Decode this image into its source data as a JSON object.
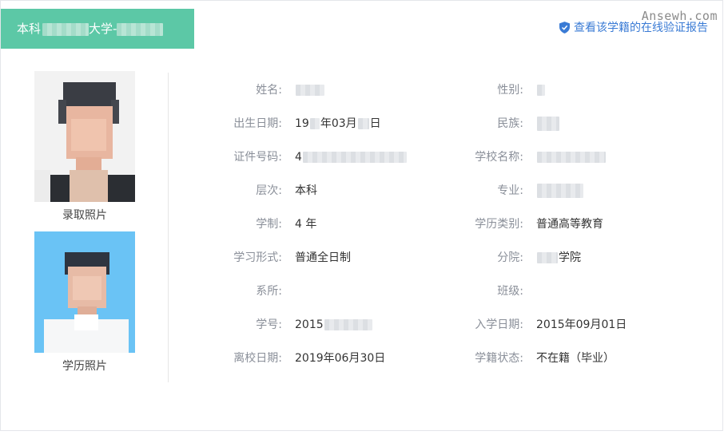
{
  "header": {
    "degree_prefix": "本科",
    "university_suffix": "大学-"
  },
  "watermark": "Ansewh.com",
  "verify_link": {
    "label": "查看该学籍的在线验证报告",
    "icon": "shield-check-icon",
    "color": "#3a7bd5"
  },
  "photos": {
    "admission_caption": "录取照片",
    "degree_caption": "学历照片"
  },
  "left_fields": [
    {
      "label": "姓名:",
      "value": ""
    },
    {
      "label": "出生日期:",
      "value_parts": [
        "19",
        "年03月",
        "日"
      ]
    },
    {
      "label": "证件号码:",
      "value": "4"
    },
    {
      "label": "层次:",
      "value": "本科"
    },
    {
      "label": "学制:",
      "value": "4 年"
    },
    {
      "label": "学习形式:",
      "value": "普通全日制"
    },
    {
      "label": "系所:",
      "value": ""
    },
    {
      "label": "学号:",
      "value": "2015"
    },
    {
      "label": "离校日期:",
      "value": "2019年06月30日"
    }
  ],
  "right_fields": [
    {
      "label": "性别:",
      "value": ""
    },
    {
      "label": "民族:",
      "value": ""
    },
    {
      "label": "学校名称:",
      "value": ""
    },
    {
      "label": "专业:",
      "value": ""
    },
    {
      "label": "学历类别:",
      "value": "普通高等教育"
    },
    {
      "label": "分院:",
      "value": "学院"
    },
    {
      "label": "班级:",
      "value": ""
    },
    {
      "label": "入学日期:",
      "value": "2015年09月01日"
    },
    {
      "label": "学籍状态:",
      "value": "不在籍（毕业）"
    }
  ],
  "colors": {
    "tag_background": "#5cc8a6",
    "label_text": "#8a8f99",
    "value_text": "#333333",
    "degree_photo_background": "#6ac3f5"
  }
}
